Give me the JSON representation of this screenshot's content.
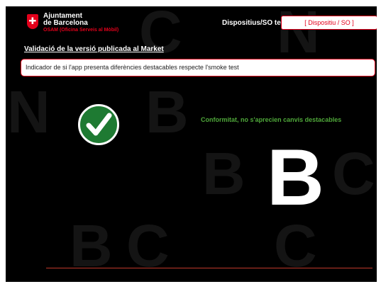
{
  "header": {
    "org_line1": "Ajuntament",
    "org_line2": "de Barcelona",
    "org_line3": "OSAM (Oficina Serveis al Mòbil)",
    "device_label": "Dispositius/SO test",
    "device_value": "[ Dispositiu  / SO ]"
  },
  "section": {
    "title": "Validació de la versió publicada al Market",
    "description": "Indicador de si l'app presenta diferències destacables respecte l'smoke test"
  },
  "result": {
    "status_icon": "check-icon",
    "message": "Conformitat, no s'aprecien canvis destacables",
    "grade": "B"
  },
  "colors": {
    "brand_red": "#e3001b",
    "success_green": "#4fa73a",
    "background": "#000000"
  }
}
